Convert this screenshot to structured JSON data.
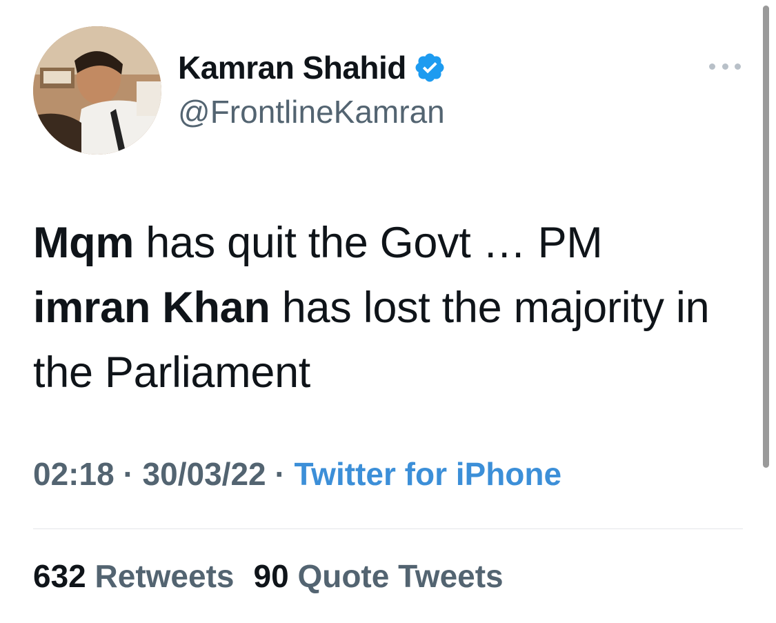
{
  "author": {
    "display_name": "Kamran Shahid",
    "handle": "@FrontlineKamran",
    "verified": true,
    "avatar_icon": "profile-photo"
  },
  "tweet": {
    "segments": [
      {
        "text": "Mqm",
        "bold": true
      },
      {
        "text": " has quit the Govt … PM ",
        "bold": false
      },
      {
        "text": "imran Khan",
        "bold": true
      },
      {
        "text": " has lost the majority in the Parliament",
        "bold": false
      }
    ]
  },
  "meta": {
    "time": "02:18",
    "separator": "·",
    "date": "30/03/22",
    "source": "Twitter for iPhone"
  },
  "stats": {
    "retweets_count": "632",
    "retweets_label": "Retweets",
    "quotes_count": "90",
    "quotes_label": "Quote Tweets"
  },
  "colors": {
    "verified_badge": "#1d9bf0",
    "link": "#3c8fd8",
    "secondary_text": "#536471"
  }
}
